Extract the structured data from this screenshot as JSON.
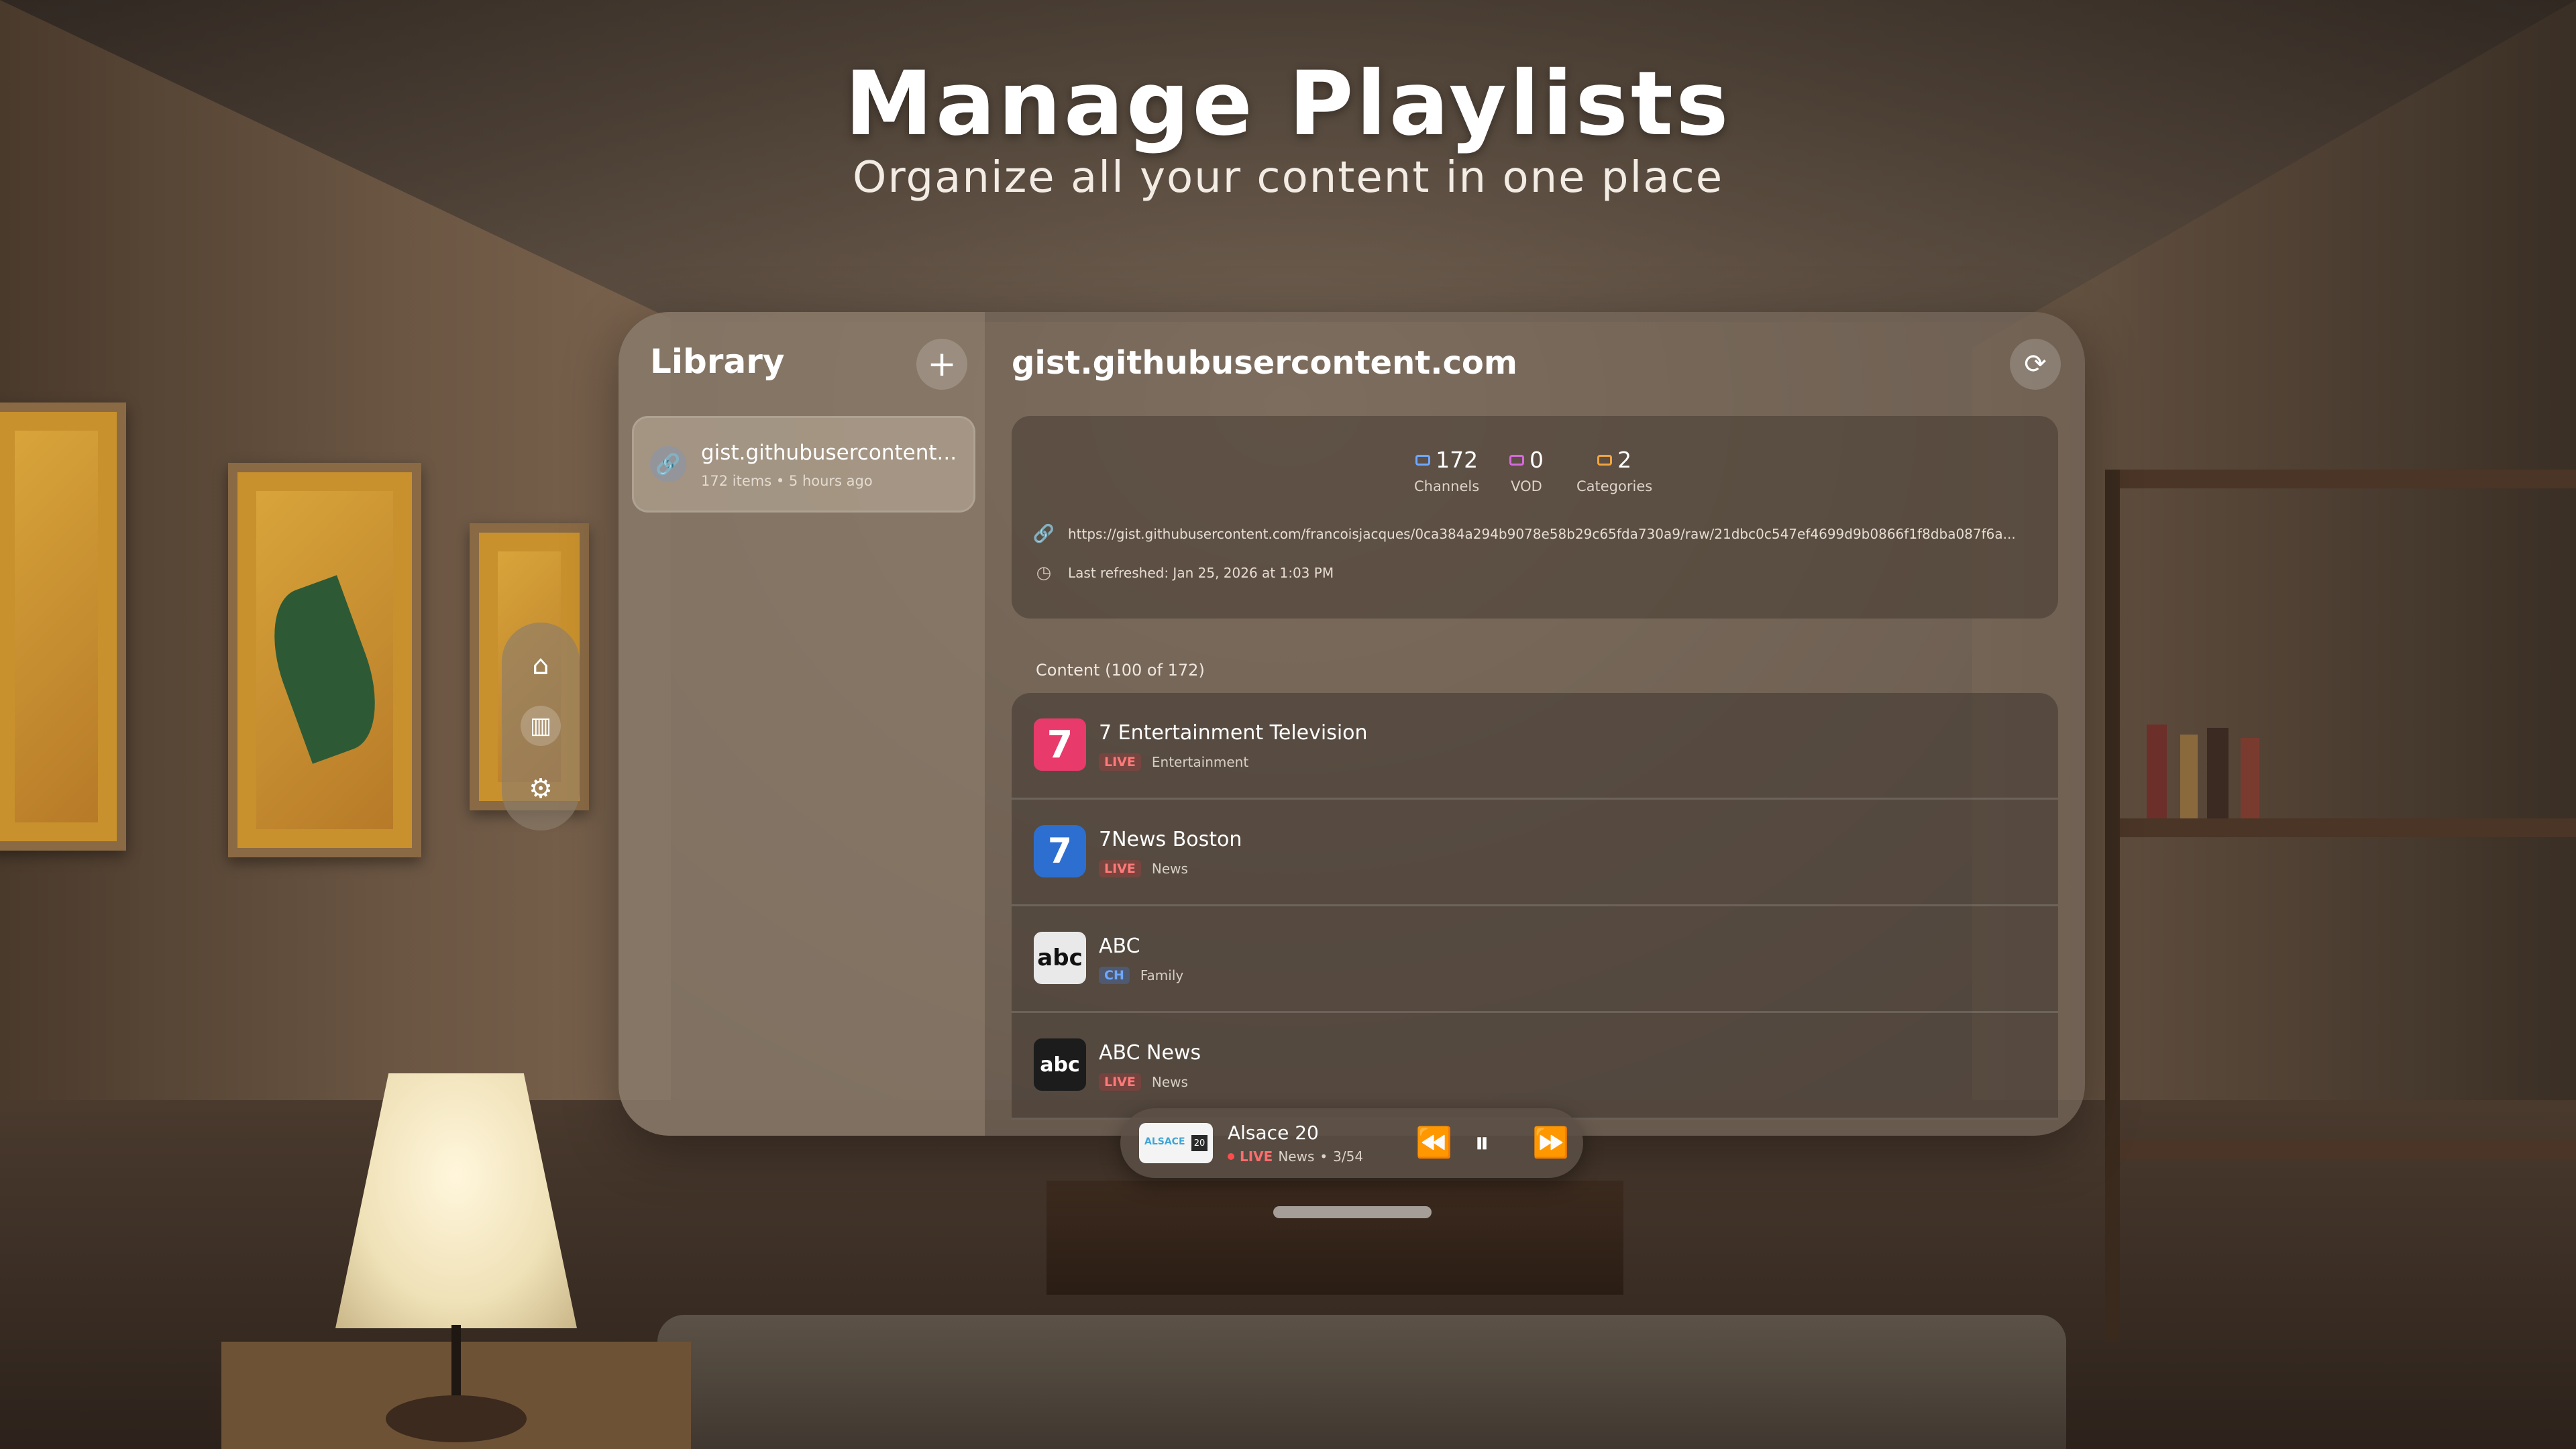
{
  "headline": {
    "title": "Manage Playlists",
    "subtitle": "Organize all your content in one place"
  },
  "sidebar": {
    "title": "Library",
    "add_icon": "plus-icon",
    "items": [
      {
        "name": "gist.githubusercontent...",
        "count": "172 items",
        "time": "5 hours ago",
        "icon": "link-icon"
      }
    ]
  },
  "main": {
    "heading": "gist.githubusercontent.com",
    "refresh_icon": "refresh-icon",
    "stats": [
      {
        "value": "172",
        "label": "Channels",
        "color": "#6fa8ff",
        "icon": "tv-icon"
      },
      {
        "value": "0",
        "label": "VOD",
        "color": "#d46bdd",
        "icon": "film-icon"
      },
      {
        "value": "2",
        "label": "Categories",
        "color": "#f0a640",
        "icon": "folder-icon"
      }
    ],
    "url": "https://gist.githubusercontent.com/francoisjacques/0ca384a294b9078e58b29c65fda730a9/raw/21dbc0c547ef4699d9b0866f1f8dba087f6a...",
    "last_refreshed": "Last refreshed: Jan 25, 2026 at 1:03 PM",
    "content_label": "Content (100 of 172)",
    "rows": [
      {
        "name": "7 Entertainment Television",
        "badge": "LIVE",
        "category": "Entertainment",
        "logo_text": "7",
        "logo_color": "#e83a6b"
      },
      {
        "name": "7News Boston",
        "badge": "LIVE",
        "category": "News",
        "logo_text": "7",
        "logo_color": "#2d6fd1"
      },
      {
        "name": "ABC",
        "badge": "CH",
        "category": "Family",
        "logo_text": "abc",
        "logo_color": "#e9e9e9"
      },
      {
        "name": "ABC News",
        "badge": "LIVE",
        "category": "News",
        "logo_text": "abc",
        "logo_color": "#1c1c1c"
      }
    ]
  },
  "nav": {
    "items": [
      "home-icon",
      "library-icon",
      "settings-icon"
    ]
  },
  "player": {
    "title": "Alsace 20",
    "live": "LIVE",
    "category": "News",
    "position": "3/54",
    "thumb_text": "ALSACE",
    "thumb_num": "20"
  }
}
